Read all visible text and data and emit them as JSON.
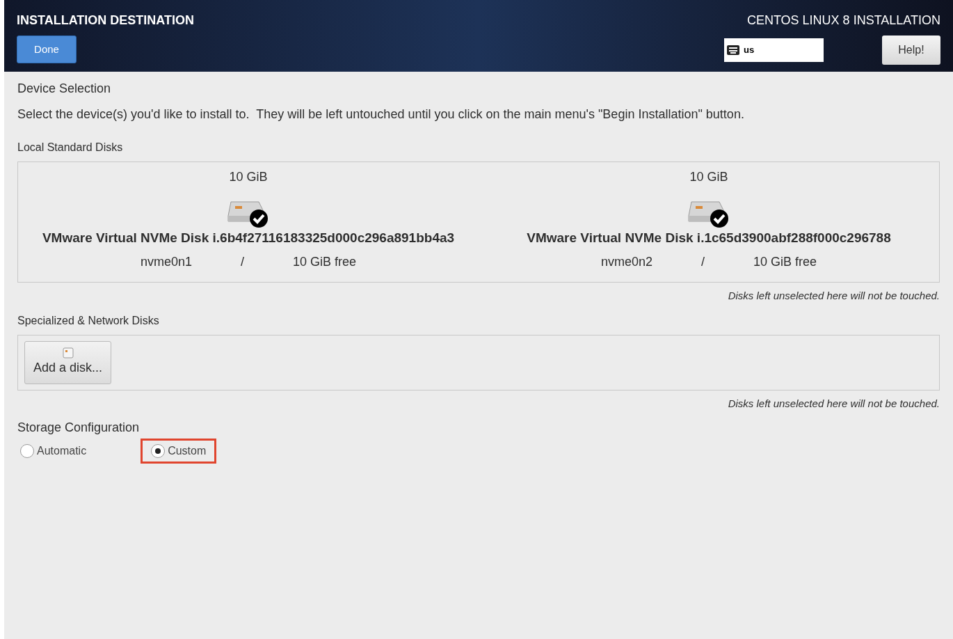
{
  "header": {
    "title": "INSTALLATION DESTINATION",
    "done_button": "Done",
    "product": "CENTOS LINUX 8 INSTALLATION",
    "keyboard_layout": "us",
    "help_button": "Help!"
  },
  "device_selection": {
    "heading": "Device Selection",
    "description": "Select the device(s) you'd like to install to.  They will be left untouched until you click on the main menu's \"Begin Installation\" button."
  },
  "local_disks": {
    "heading": "Local Standard Disks",
    "disks": [
      {
        "size": "10 GiB",
        "name": "VMware Virtual NVMe Disk i.6b4f27116183325d000c296a891bb4a3",
        "device": "nvme0n1",
        "mount": "/",
        "free": "10 GiB free",
        "selected": true
      },
      {
        "size": "10 GiB",
        "name": "VMware Virtual NVMe Disk i.1c65d3900abf288f000c296788",
        "device": "nvme0n2",
        "mount": "/",
        "free": "10 GiB free",
        "selected": true
      }
    ],
    "note": "Disks left unselected here will not be touched."
  },
  "network_disks": {
    "heading": "Specialized & Network Disks",
    "add_button": "Add a disk...",
    "note": "Disks left unselected here will not be touched."
  },
  "storage_configuration": {
    "heading": "Storage Configuration",
    "options": [
      {
        "label": "Automatic",
        "selected": false,
        "highlighted": false
      },
      {
        "label": "Custom",
        "selected": true,
        "highlighted": true
      }
    ]
  }
}
